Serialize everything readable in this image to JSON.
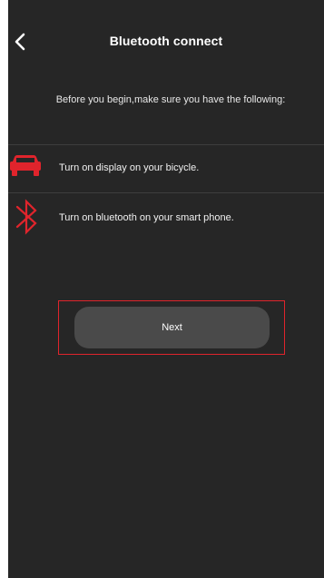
{
  "header": {
    "title": "Bluetooth connect",
    "back_icon": "chevron-left-icon"
  },
  "intro": {
    "text": "Before you begin,make sure you have the following:"
  },
  "requirements": [
    {
      "icon": "display-icon",
      "label": "Turn on display on your bicycle."
    },
    {
      "icon": "bluetooth-icon",
      "label": "Turn on bluetooth on your smart phone."
    }
  ],
  "actions": {
    "next_label": "Next"
  },
  "colors": {
    "background": "#262626",
    "accent": "#e0242c",
    "button": "#4a4a4a",
    "text": "#ffffff",
    "divider": "#3d3d3d"
  }
}
